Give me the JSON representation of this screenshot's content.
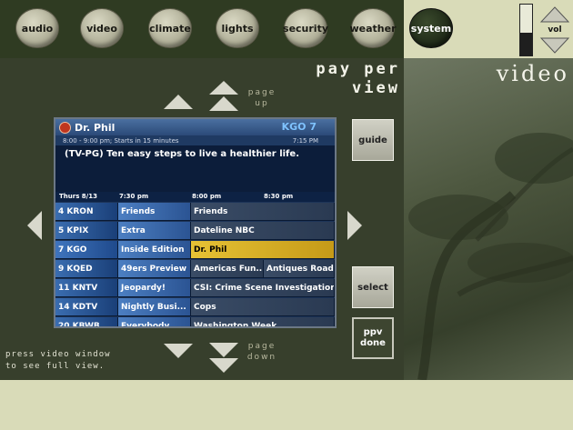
{
  "nav": {
    "buttons": [
      {
        "id": "audio",
        "label": "audio"
      },
      {
        "id": "video",
        "label": "video"
      },
      {
        "id": "climate",
        "label": "climate"
      },
      {
        "id": "lights",
        "label": "lights"
      },
      {
        "id": "security",
        "label": "security"
      },
      {
        "id": "weather",
        "label": "weather"
      },
      {
        "id": "system",
        "label": "system"
      }
    ]
  },
  "volume": {
    "label": "vol",
    "level": 0.45
  },
  "header": {
    "ppv_line1": "pay per",
    "ppv_line2": "view",
    "section": "video"
  },
  "pager": {
    "up_line1": "page",
    "up_line2": "up",
    "down_line1": "page",
    "down_line2": "down"
  },
  "controls": {
    "guide": "guide",
    "select": "select",
    "ppv_done_line1": "ppv",
    "ppv_done_line2": "done"
  },
  "hint": {
    "line1": "press video window",
    "line2": "to see full view."
  },
  "guide": {
    "program_title": "Dr. Phil",
    "channel": "KGO 7",
    "time_info": "8:00 - 9:00 pm; Starts in 15 minutes",
    "current_time": "7:15 PM",
    "description": "(TV-PG) Ten easy steps to live a healthier life.",
    "date": "Thurs 8/13",
    "times": [
      "7:30 pm",
      "8:00 pm",
      "8:30 pm"
    ],
    "rows": [
      {
        "channel": "4 KRON",
        "progs": [
          "Friends",
          "Friends"
        ]
      },
      {
        "channel": "5 KPIX",
        "progs": [
          "Extra",
          "Dateline NBC"
        ]
      },
      {
        "channel": "7 KGO",
        "progs": [
          "Inside Edition",
          "Dr. Phil"
        ]
      },
      {
        "channel": "9 KQED",
        "progs": [
          "49ers Preview",
          "Americas Fun..",
          "Antiques Road.."
        ]
      },
      {
        "channel": "11 KNTV",
        "progs": [
          "Jeopardy!",
          "CSI: Crime Scene Investigation"
        ]
      },
      {
        "channel": "14 KDTV",
        "progs": [
          "Nightly Busi...",
          "Cops"
        ]
      },
      {
        "channel": "20 KBWB",
        "progs": [
          "Everybody...",
          "Washington Week"
        ]
      }
    ],
    "highlighted_row": 2
  }
}
